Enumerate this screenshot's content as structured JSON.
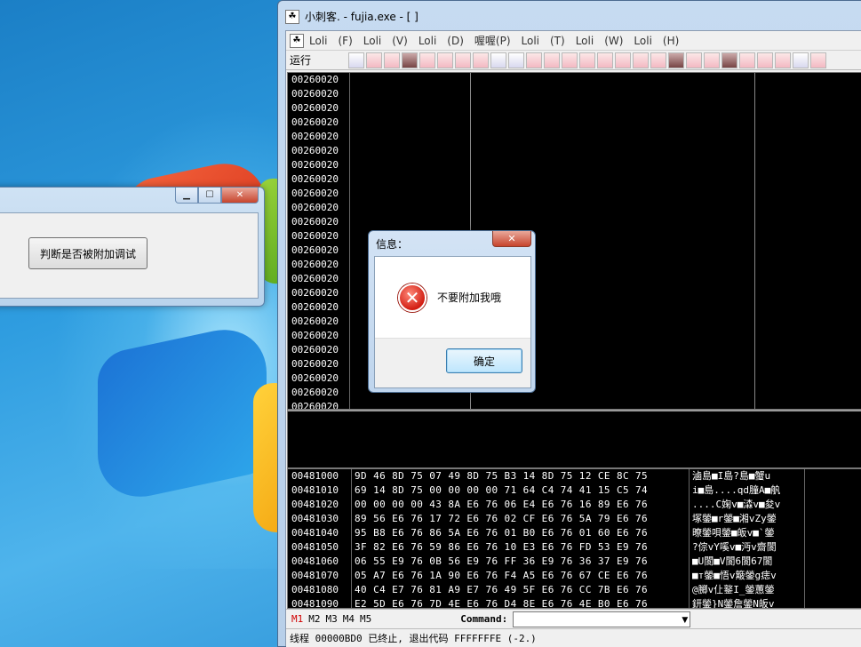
{
  "desktop": {},
  "detect_window": {
    "button_label": "判断是否被附加调试",
    "minimize": "▁",
    "maximize": "☐",
    "close": "✕"
  },
  "olly": {
    "title": "小刺客. - fujia.exe - [  ]",
    "menu": [
      "Loli",
      "(F)",
      "Loli",
      "(V)",
      "Loli",
      "(D)",
      "喔喔(P)",
      "Loli",
      "(T)",
      "Loli",
      "(W)",
      "Loli",
      "(H)"
    ],
    "toolbar_label": "运行",
    "cpu_addresses": [
      "00260020",
      "00260020",
      "00260020",
      "00260020",
      "00260020",
      "00260020",
      "00260020",
      "00260020",
      "00260020",
      "00260020",
      "00260020",
      "00260020",
      "00260020",
      "00260020",
      "00260020",
      "00260020",
      "00260020",
      "00260020",
      "00260020",
      "00260020",
      "00260020",
      "00260020",
      "00260020",
      "00260020"
    ],
    "dump_rows": [
      {
        "addr": "00481000",
        "hex": "9D 46 8D 75 07 49 8D 75 B3 14 8D 75 12 CE 8C 75",
        "ascii": "滷島■I島?島■蟹u"
      },
      {
        "addr": "00481010",
        "hex": "69 14 8D 75 00 00 00 00 71 64 C4 74 41 15 C5 74",
        "ascii": "i■島....qd膧A■舧"
      },
      {
        "addr": "00481020",
        "hex": "00 00 00 00 43 8A E6 76 06 E4 E6 76 16 89 E6 76",
        "ascii": "....C婅v■潹v■夋v"
      },
      {
        "addr": "00481030",
        "hex": "89 56 E6 76 17 72 E6 76 02 CF E6 76 5A 79 E6 76",
        "ascii": "塚鎣■r鎣■湘vZy鎣"
      },
      {
        "addr": "00481040",
        "hex": "95 B8 E6 76 86 5A E6 76 01 B0 E6 76 01 60 E6 76",
        "ascii": "暸鎣唄鎣■皈v■`鎣"
      },
      {
        "addr": "00481050",
        "hex": "3F 82 E6 76 59 86 E6 76 10 E3 E6 76 FD 53 E9 76",
        "ascii": "?倧vY嗘v■沔v齋閬"
      },
      {
        "addr": "00481060",
        "hex": "06 55 E9 76 0B 56 E9 76 FF 36 E9 76 36 37 E9 76",
        "ascii": "■U閬■V閬6閬67閬"
      },
      {
        "addr": "00481070",
        "hex": "05 A7 E6 76 1A 90 E6 76 F4 A5 E6 76 67 CE E6 76",
        "ascii": "■т鎣■悟v簸鎣g痣v"
      },
      {
        "addr": "00481080",
        "hex": "40 C4 E7 76 81 A9 E7 76 49 5F E6 76 CC 7B E6 76",
        "ascii": "@膷v仩鐜I_鎣蕙鎣"
      },
      {
        "addr": "00481090",
        "hex": "E2 5D E6 76 7D 4E E6 76 D4 8E E6 76 4E B0 E6 76",
        "ascii": "鈃鎣}N鎣詹鎣N皈v"
      }
    ],
    "mem_tabs": [
      "M1",
      "M2",
      "M3",
      "M4",
      "M5"
    ],
    "command_label": "Command:",
    "command_value": "",
    "status": "线程 00000BD0 已终止, 退出代码 FFFFFFFE (-2.)"
  },
  "msgbox": {
    "title": "信息：",
    "close": "✕",
    "message": "不要附加我哦",
    "ok_label": "确定",
    "icon": "error-icon"
  }
}
